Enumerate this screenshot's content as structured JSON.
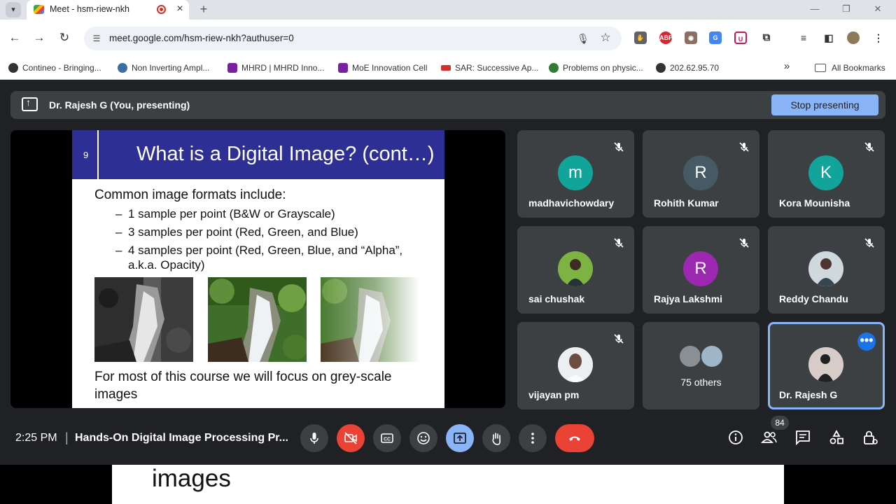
{
  "browser": {
    "tab_title": "Meet - hsm-riew-nkh",
    "url": "meet.google.com/hsm-riew-nkh?authuser=0",
    "bookmarks": [
      "Contineo - Bringing...",
      "Non Inverting Ampl...",
      "MHRD | MHRD Inno...",
      "MoE Innovation Cell",
      "SAR: Successive Ap...",
      "Problems on physic...",
      "202.62.95.70"
    ],
    "all_bookmarks": "All Bookmarks",
    "extensions": [
      "ABP"
    ]
  },
  "meet": {
    "presenting_label": "Dr. Rajesh G (You, presenting)",
    "stop_button": "Stop presenting",
    "slide": {
      "number": "9",
      "title": "What is a Digital Image? (cont…)",
      "intro": "Common image formats include:",
      "bullets": [
        "1 sample per point (B&W or Grayscale)",
        "3 samples per point (Red, Green, and Blue)",
        "4 samples per point (Red, Green, Blue, and “Alpha”, a.k.a. Opacity)"
      ],
      "outro": "For most of this course we will focus on grey-scale images"
    },
    "participants": [
      {
        "name": "madhavichowdary",
        "initial": "m",
        "color": "#12a39a"
      },
      {
        "name": "Rohith Kumar",
        "initial": "R",
        "color": "#455a64"
      },
      {
        "name": "Kora Mounisha",
        "initial": "K",
        "color": "#12a39a"
      },
      {
        "name": "sai chushak",
        "initial": "",
        "color": "#6aa84f"
      },
      {
        "name": "Rajya Lakshmi",
        "initial": "R",
        "color": "#9c27b0"
      },
      {
        "name": "Reddy Chandu",
        "initial": "",
        "color": "#b0b8c0"
      },
      {
        "name": "vijayan pm",
        "initial": "",
        "color": "#d9d9d9"
      },
      {
        "name": "75 others",
        "initial": "",
        "color": "#8a8f96"
      },
      {
        "name": "Dr. Rajesh G",
        "initial": "",
        "color": "#c8c2b4"
      }
    ],
    "time": "2:25 PM",
    "meeting_title": "Hands-On Digital Image Processing Pr...",
    "people_count": "84",
    "colors": {
      "end_call": "#ea4335",
      "camera_off": "#ea4335",
      "present_active": "#8ab4f8",
      "accent": "#1a73e8"
    }
  },
  "caption": "images"
}
